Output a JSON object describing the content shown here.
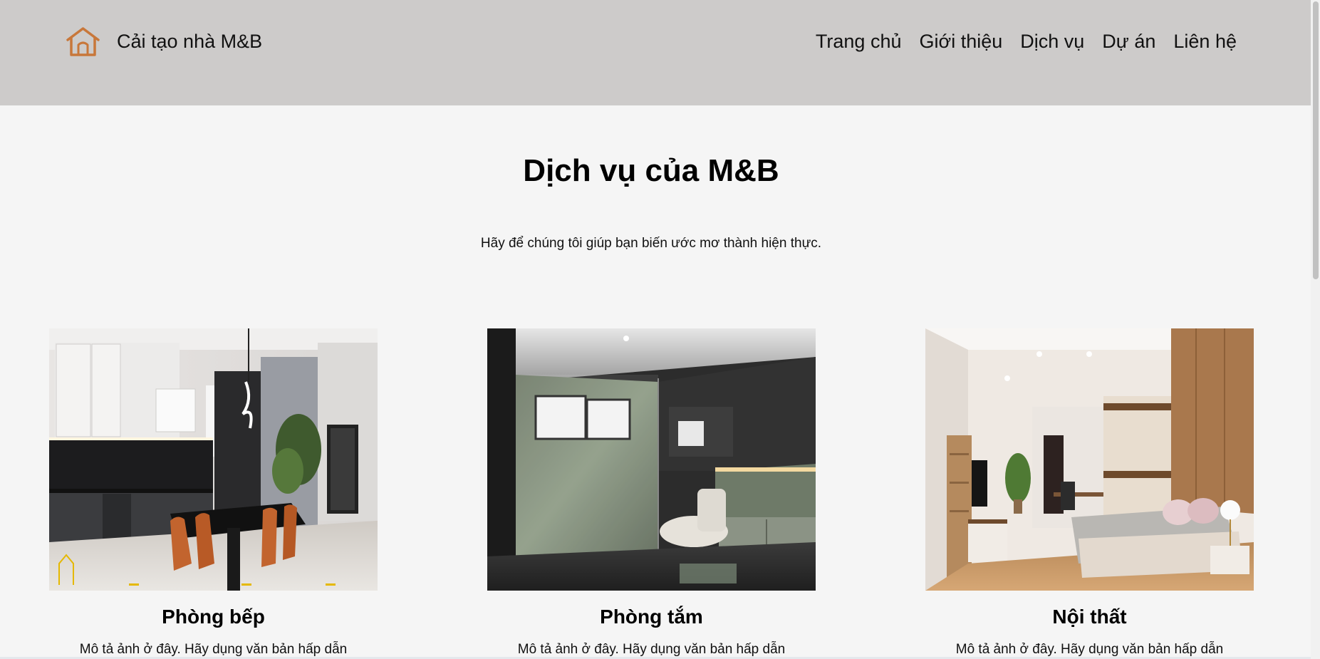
{
  "header": {
    "brand": "Cải tạo nhà M&B",
    "logo_icon": "house-outline-icon",
    "logo_color": "#c8773a",
    "nav": [
      {
        "label": "Trang chủ"
      },
      {
        "label": "Giới thiệu"
      },
      {
        "label": "Dịch vụ"
      },
      {
        "label": "Dự án"
      },
      {
        "label": "Liên hệ"
      }
    ]
  },
  "main": {
    "title": "Dịch vụ của M&B",
    "subtitle": "Hãy để chúng tôi giúp bạn biến ước mơ thành hiện thực.",
    "services": [
      {
        "name": "Phòng bếp",
        "description": "Mô tả ảnh ở đây. Hãy dụng văn bản hấp dẫn"
      },
      {
        "name": "Phòng tắm",
        "description": "Mô tả ảnh ở đây. Hãy dụng văn bản hấp dẫn"
      },
      {
        "name": "Nội thất",
        "description": "Mô tả ảnh ở đây. Hãy dụng văn bản hấp dẫn"
      }
    ]
  },
  "colors": {
    "header_bg": "#cdcbca",
    "page_bg": "#f5f5f5",
    "accent": "#c8773a"
  }
}
